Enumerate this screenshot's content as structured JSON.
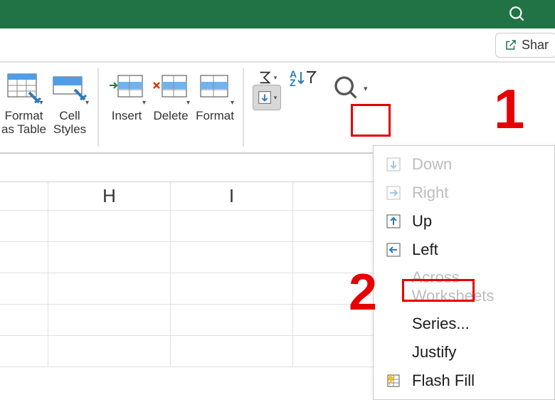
{
  "titlebar": {
    "search_icon": "search"
  },
  "share": {
    "label": "Shar"
  },
  "ribbon": {
    "format_table": "Format\nas Table",
    "cell_styles": "Cell\nStyles",
    "insert": "Insert",
    "delete": "Delete",
    "format": "Format"
  },
  "columns": [
    "H",
    "I"
  ],
  "dropdown": {
    "down": "Down",
    "right": "Right",
    "up": "Up",
    "left": "Left",
    "across": "Across Worksheets",
    "series": "Series...",
    "justify": "Justify",
    "flash": "Flash Fill"
  },
  "annotations": {
    "n1": "1",
    "n2": "2"
  }
}
